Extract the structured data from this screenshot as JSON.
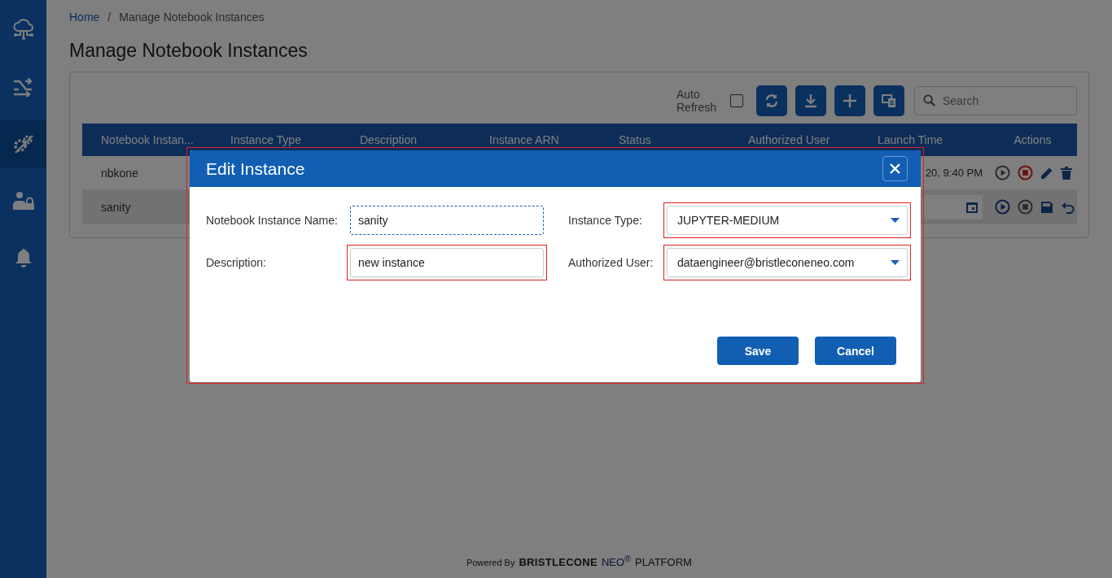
{
  "sidebar": {
    "items": [
      {
        "kind": "cloud",
        "selected": false
      },
      {
        "kind": "shuffle",
        "selected": false
      },
      {
        "kind": "gears",
        "selected": true
      },
      {
        "kind": "user-lock",
        "selected": false
      },
      {
        "kind": "bell",
        "selected": false
      }
    ]
  },
  "breadcrumb": [
    {
      "label": "Home",
      "link": true
    },
    {
      "label": "/",
      "link": false
    },
    {
      "label": "Manage Notebook Instances",
      "link": false
    }
  ],
  "page_title": "Manage Notebook Instances",
  "toolbar": {
    "auto_refresh": {
      "label": "Auto Refresh",
      "checked": false
    },
    "buttons": [
      {
        "kind": "refresh"
      },
      {
        "kind": "download"
      },
      {
        "kind": "add"
      },
      {
        "kind": "columns"
      }
    ],
    "search": {
      "placeholder": "Search"
    }
  },
  "table": {
    "columns": [
      "Notebook Instan...",
      "Instance Type",
      "Description",
      "Instance ARN",
      "Status",
      "Authorized User",
      "Launch Time",
      "Actions"
    ],
    "rows": [
      {
        "name": "nbkone",
        "launch_time": "20, 9:40 PM",
        "selected": false,
        "editing": false
      },
      {
        "name": "sanity",
        "selected": true,
        "editing": true
      }
    ]
  },
  "modal": {
    "title": "Edit Instance",
    "invalid": true,
    "fields": [
      {
        "label": "Notebook Instance Name:",
        "value": "sanity",
        "kind": "text",
        "focused": true,
        "invalid": false
      },
      {
        "label": "Instance Type:",
        "value": "JUPYTER-MEDIUM",
        "kind": "select",
        "focused": false,
        "invalid": true
      },
      {
        "label": "Description:",
        "value": "new instance",
        "kind": "text",
        "focused": false,
        "invalid": true
      },
      {
        "label": "Authorized User:",
        "value": "dataengineer@bristleconeneo.com",
        "kind": "select",
        "focused": false,
        "invalid": true
      }
    ],
    "buttons": [
      "Save",
      "Cancel"
    ]
  },
  "footer": {
    "powered_by": "Powered By",
    "brand": "BRISTLECONE",
    "product": "NEO$^{®}$",
    "platform": "PLATFORM"
  }
}
